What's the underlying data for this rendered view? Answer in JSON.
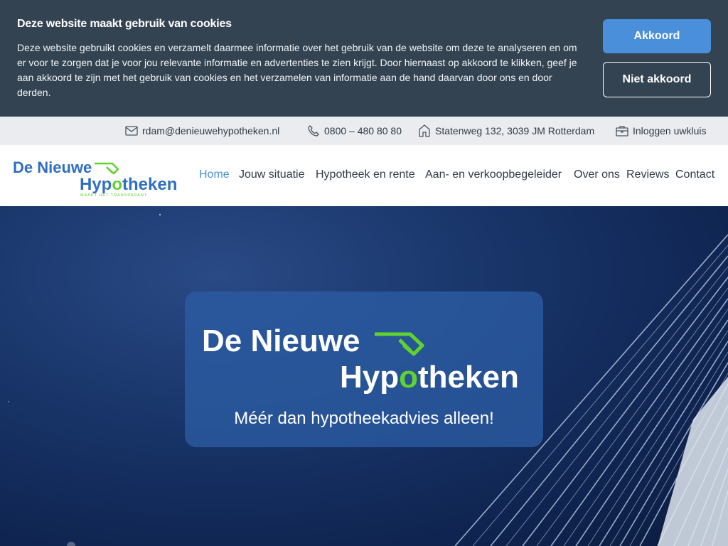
{
  "cookie": {
    "title": "Deze website maakt gebruik van cookies",
    "text": "Deze website gebruikt cookies en verzamelt daarmee informatie over het gebruik van de website om deze te analyseren en om er voor te zorgen dat je voor jou relevante informatie en advertenties te zien krijgt. Door hiernaast op akkoord te klikken, geef je aan akkoord te zijn met het gebruik van cookies en het verzamelen van informatie aan de hand daarvan door ons en door derden.",
    "accept_label": "Akkoord",
    "decline_label": "Niet akkoord"
  },
  "topbar": {
    "email": "rdam@denieuwehypotheken.nl",
    "phone": "0800 – 480 80 80",
    "address": "Statenweg 132, 3039 JM Rotterdam",
    "login": "Inloggen uwkluis"
  },
  "brand": {
    "line1": "De Nieuwe",
    "line2_a": "Hyp",
    "line2_b": "o",
    "line2_c": "theken",
    "slogan": "MAAKT HET TRANSPARANT"
  },
  "nav": {
    "items": [
      {
        "label": "Home",
        "active": true
      },
      {
        "label": "Jouw situatie"
      },
      {
        "label": "Hypotheek en rente"
      },
      {
        "label": "Aan- en verkoopbegeleider"
      },
      {
        "label": "Over ons"
      },
      {
        "label": "Reviews"
      },
      {
        "label": "Contact"
      }
    ]
  },
  "hero": {
    "tagline": "Méér dan hypotheekadvies alleen!"
  },
  "colors": {
    "accent": "#4a8fd9",
    "brand_green": "#5fd22e",
    "brand_blue": "#2f6fc1",
    "cookie_bg": "#344352"
  }
}
